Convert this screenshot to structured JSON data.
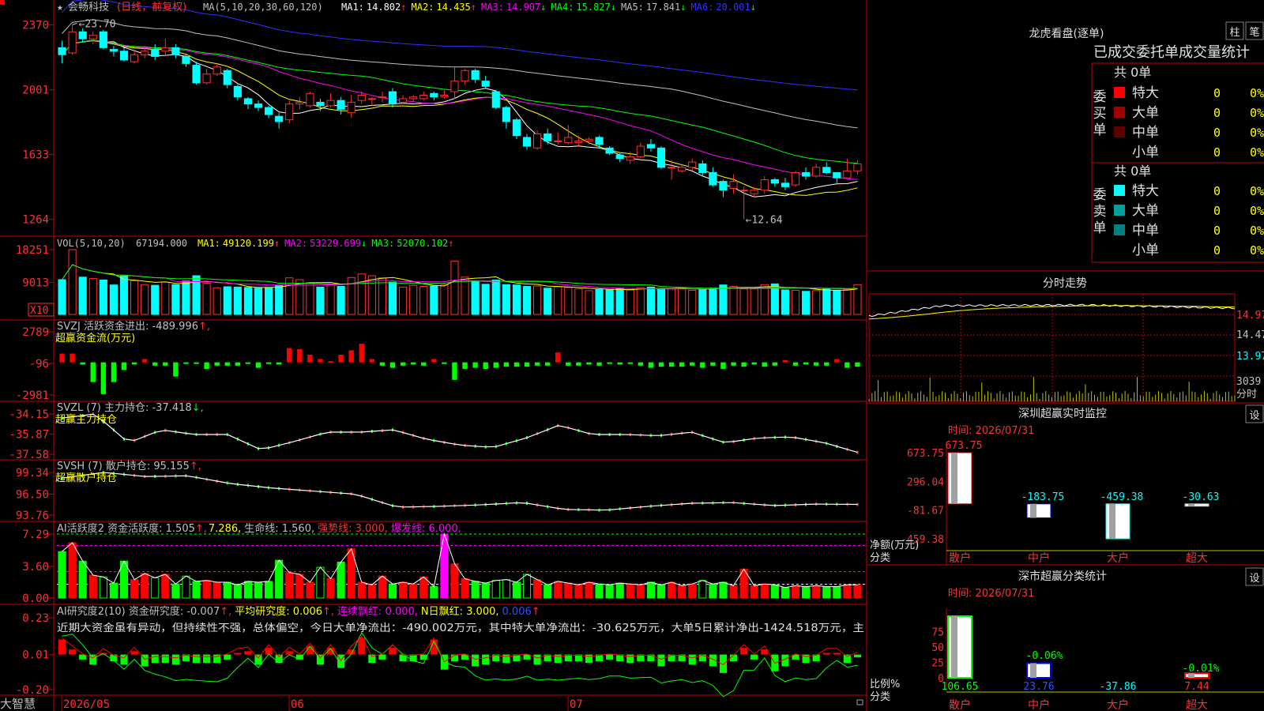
{
  "stock": {
    "name": "会畅科技",
    "period": "(日线，前复权)",
    "star": "★"
  },
  "main": {
    "ma_prefix": "MA(5,10,20,30,60,120)",
    "ma": [
      {
        "label": "MA1:",
        "value": "14.802",
        "arrow": "↑",
        "color": "#ffffff"
      },
      {
        "label": "MA2:",
        "value": "14.435",
        "arrow": "↑",
        "color": "#ffff00"
      },
      {
        "label": "MA3:",
        "value": "14.907",
        "arrow": "↓",
        "color": "#ff00ff"
      },
      {
        "label": "MA4:",
        "value": "15.827",
        "arrow": "↓",
        "color": "#00ff00"
      },
      {
        "label": "MA5:",
        "value": "17.841",
        "arrow": "↓",
        "color": "#c0c0c0"
      },
      {
        "label": "MA6:",
        "value": "20.001",
        "arrow": "↓",
        "color": "#3030ff"
      }
    ],
    "y_ticks": [
      "2370",
      "2001",
      "1633",
      "1264"
    ],
    "high_label": "23.70",
    "low_label": "12.64"
  },
  "vol": {
    "prefix": "VOL(5,10,20)",
    "value": "67194.000",
    "ma": [
      {
        "label": "MA1:",
        "value": "49120.199",
        "arrow": "↑",
        "color": "#ffff00"
      },
      {
        "label": "MA2:",
        "value": "53229.699",
        "arrow": "↓",
        "color": "#ff00ff"
      },
      {
        "label": "MA3:",
        "value": "52070.102",
        "arrow": "↑",
        "color": "#00ff00"
      }
    ],
    "y_ticks": [
      "18251",
      "9013"
    ],
    "unit": "X10"
  },
  "svzj": {
    "line1": "SVZJ  活跃资金进出: -489.996",
    "arrow": "↑,",
    "line2": "超赢资金流(万元)",
    "y_ticks": [
      "2789",
      "-96",
      "-2981"
    ]
  },
  "svzl": {
    "line1": "SVZL  (7) 主力持仓: -37.418",
    "arrow": "↓,",
    "line2": "超赢主力持仓",
    "y_ticks": [
      "-34.15",
      "-35.87",
      "-37.58"
    ]
  },
  "svsh": {
    "line1": "SVSH  (7) 散户持仓: 95.155",
    "arrow": "↑,",
    "line2": "超赢散户持仓",
    "y_ticks": [
      "99.34",
      "96.50",
      "93.76"
    ]
  },
  "ai_act": {
    "prefix": "AI活跃度2 资金活跃度: 1.505",
    "a1": "↑,",
    "v2": "7.286,",
    "v3": "生命线: 1.560,",
    "v4": "强势线: 3.000,",
    "v5": "爆发线: 6.000,",
    "y_ticks": [
      "7.29",
      "3.60",
      "0.00"
    ]
  },
  "ai_res": {
    "prefix": "AI研究度2(10) 资金研究度: -0.007",
    "a1": "↑,",
    "v2": "平均研究度: 0.006",
    "a2": "↑,",
    "v3": "连续飘红: 0.000,",
    "v4": "N日飘红: 3.000,",
    "v5": "0.006",
    "a5": "↑",
    "comment": "近期大资金虽有异动，但持续性不强，总体偏空，今日大单净流出：-490.002万元，其中特大单净流出：-30.625万元，大单5日累计净出-1424.518万元，主",
    "y_ticks": [
      "0.23",
      "0.01",
      "-0.20"
    ]
  },
  "xaxis": {
    "labels": [
      "2026/05",
      "06",
      "07"
    ],
    "brand": "大智慧"
  },
  "lhb": {
    "title": "龙虎看盘(逐单)",
    "btn1": "柱",
    "btn2": "笔",
    "subtitle": "已成交委托单成交量统计",
    "buy": {
      "side": "委买单",
      "total": "共 0单",
      "rows": [
        {
          "label": "特大",
          "count": "0",
          "pct": "0%",
          "color": "#ff0000"
        },
        {
          "label": "大单",
          "count": "0",
          "pct": "0%",
          "color": "#a00000"
        },
        {
          "label": "中单",
          "count": "0",
          "pct": "0%",
          "color": "#600000"
        },
        {
          "label": "小单",
          "count": "0",
          "pct": "0%",
          "color": "#000000"
        }
      ]
    },
    "sell": {
      "side": "委卖单",
      "total": "共 0单",
      "rows": [
        {
          "label": "特大",
          "count": "0",
          "pct": "0%",
          "color": "#00ffff"
        },
        {
          "label": "大单",
          "count": "0",
          "pct": "0%",
          "color": "#00a0a0"
        },
        {
          "label": "中单",
          "count": "0",
          "pct": "0%",
          "color": "#008080"
        },
        {
          "label": "小单",
          "count": "0",
          "pct": "0%",
          "color": "#000000"
        }
      ]
    }
  },
  "intraday": {
    "title": "分时走势",
    "y_ticks": [
      "14.97",
      "14.47",
      "13.97"
    ],
    "vol_tick": "3039",
    "vol_label": "分时"
  },
  "monitor": {
    "title": "深圳超赢实时监控",
    "btn": "设",
    "time": "时间: 2026/07/31",
    "y_ticks": [
      "673.75",
      "296.04",
      "-81.67",
      "-459.38"
    ],
    "y_label": "净额(万元)",
    "x_label": "分类",
    "cats": [
      "散户",
      "中户",
      "大户",
      "超大"
    ],
    "values": [
      "673.75",
      "-183.75",
      "-459.38",
      "-30.63"
    ]
  },
  "classify": {
    "title": "深市超赢分类统计",
    "btn": "设",
    "time": "时间: 2026/07/31",
    "y_ticks": [
      "75",
      "50",
      "25",
      "0"
    ],
    "y_label": "比例%",
    "x_label": "分类",
    "cats": [
      "散户",
      "中户",
      "大户",
      "超大"
    ],
    "values": [
      "106.65",
      "23.76",
      "-37.86",
      "7.44"
    ],
    "bar_labels": [
      "-0.06%",
      "-0.01%"
    ]
  },
  "chart_data": [
    {
      "type": "candlestick",
      "title": "会畅科技",
      "ylim": [
        12.0,
        24.3
      ],
      "candles": [
        [
          22.4,
          22.0,
          22.8,
          21.5
        ],
        [
          22.1,
          23.3,
          23.7,
          22.0
        ],
        [
          23.3,
          22.9,
          23.5,
          22.7
        ],
        [
          22.9,
          23.1,
          23.3,
          22.6
        ],
        [
          23.3,
          22.4,
          23.4,
          22.3
        ],
        [
          22.3,
          22.2,
          22.5,
          21.9
        ],
        [
          22.2,
          21.7,
          22.4,
          21.6
        ],
        [
          21.6,
          22.0,
          22.3,
          21.5
        ],
        [
          22.0,
          22.2,
          22.5,
          21.8
        ],
        [
          22.3,
          21.9,
          22.6,
          21.7
        ],
        [
          22.2,
          22.4,
          22.9,
          21.9
        ],
        [
          22.4,
          22.0,
          22.6,
          21.8
        ],
        [
          21.9,
          21.5,
          22.0,
          21.3
        ],
        [
          21.4,
          20.4,
          21.6,
          20.3
        ],
        [
          20.4,
          20.9,
          21.2,
          20.3
        ],
        [
          20.9,
          21.3,
          21.5,
          20.8
        ],
        [
          21.1,
          20.3,
          21.2,
          20.1
        ],
        [
          20.2,
          19.6,
          20.3,
          19.4
        ],
        [
          19.5,
          19.2,
          19.6,
          18.9
        ],
        [
          19.2,
          19.0,
          19.4,
          18.8
        ],
        [
          19.0,
          18.6,
          19.1,
          18.4
        ],
        [
          18.5,
          18.2,
          18.7,
          17.8
        ],
        [
          18.3,
          19.2,
          19.4,
          18.1
        ],
        [
          19.2,
          19.3,
          19.6,
          18.9
        ],
        [
          19.1,
          19.8,
          19.9,
          19.0
        ],
        [
          19.3,
          19.1,
          19.5,
          18.8
        ],
        [
          19.1,
          19.4,
          19.8,
          19.0
        ],
        [
          19.4,
          18.9,
          19.6,
          18.6
        ],
        [
          18.7,
          19.3,
          19.7,
          18.4
        ],
        [
          19.4,
          19.7,
          19.9,
          19.2
        ],
        [
          19.5,
          19.5,
          19.6,
          19.1
        ],
        [
          19.6,
          19.6,
          19.9,
          19.3
        ],
        [
          19.9,
          19.2,
          20.1,
          19.0
        ],
        [
          19.3,
          19.5,
          19.7,
          19.2
        ],
        [
          19.5,
          19.6,
          19.7,
          19.3
        ],
        [
          19.5,
          19.7,
          19.9,
          19.4
        ],
        [
          19.8,
          19.6,
          19.9,
          19.4
        ],
        [
          19.6,
          19.7,
          20.0,
          19.5
        ],
        [
          19.9,
          20.5,
          21.3,
          19.5
        ],
        [
          20.5,
          21.1,
          21.2,
          20.3
        ],
        [
          21.1,
          20.6,
          21.2,
          20.4
        ],
        [
          20.5,
          20.2,
          20.8,
          20.1
        ],
        [
          19.9,
          19.0,
          20.0,
          18.9
        ],
        [
          19.0,
          18.2,
          19.1,
          17.8
        ],
        [
          18.3,
          17.4,
          18.4,
          17.2
        ],
        [
          17.3,
          16.8,
          17.5,
          16.6
        ],
        [
          16.7,
          17.5,
          17.7,
          16.6
        ],
        [
          17.5,
          17.1,
          17.8,
          16.9
        ],
        [
          17.1,
          17.1,
          17.6,
          16.9
        ],
        [
          17.0,
          17.3,
          18.0,
          16.9
        ],
        [
          17.0,
          17.1,
          17.4,
          16.8
        ],
        [
          17.1,
          17.2,
          17.3,
          16.9
        ],
        [
          17.3,
          16.9,
          17.4,
          16.7
        ],
        [
          16.7,
          16.4,
          16.8,
          16.3
        ],
        [
          16.3,
          16.1,
          16.4,
          15.9
        ],
        [
          16.0,
          16.2,
          16.5,
          15.8
        ],
        [
          16.2,
          16.8,
          17.0,
          16.1
        ],
        [
          16.9,
          16.7,
          17.2,
          16.5
        ],
        [
          16.7,
          15.6,
          16.8,
          15.5
        ],
        [
          15.6,
          15.6,
          16.0,
          14.9
        ],
        [
          15.4,
          15.6,
          15.8,
          15.3
        ],
        [
          15.6,
          15.9,
          16.1,
          15.4
        ],
        [
          15.8,
          15.3,
          16.0,
          15.1
        ],
        [
          15.3,
          14.6,
          15.6,
          14.5
        ],
        [
          14.8,
          14.3,
          14.9,
          13.9
        ],
        [
          14.4,
          14.8,
          15.2,
          14.1
        ],
        [
          14.3,
          14.3,
          14.5,
          12.64
        ],
        [
          14.1,
          14.3,
          14.5,
          13.9
        ],
        [
          14.3,
          14.9,
          15.1,
          14.1
        ],
        [
          14.9,
          14.7,
          15.0,
          14.5
        ],
        [
          14.7,
          14.5,
          15.0,
          14.3
        ],
        [
          14.6,
          15.3,
          15.4,
          14.5
        ],
        [
          15.3,
          15.1,
          15.6,
          14.9
        ],
        [
          15.1,
          15.6,
          15.8,
          15.0
        ],
        [
          15.6,
          15.3,
          15.9,
          15.2
        ],
        [
          15.3,
          15.0,
          15.3,
          14.7
        ],
        [
          15.0,
          15.4,
          16.1,
          15.0
        ],
        [
          15.4,
          15.8,
          16.0,
          15.2
        ]
      ],
      "ma_series": [
        {
          "name": "MA1",
          "last": 14.802
        },
        {
          "name": "MA2",
          "last": 14.435
        },
        {
          "name": "MA3",
          "last": 14.907
        },
        {
          "name": "MA4",
          "last": 15.827
        },
        {
          "name": "MA5",
          "last": 17.841
        },
        {
          "name": "MA6",
          "last": 20.001
        }
      ],
      "high": 23.7,
      "low": 12.64
    },
    {
      "type": "bar",
      "title": "VOL",
      "ylim": [
        0,
        18251
      ],
      "values": [
        9800,
        18251,
        10500,
        10100,
        9700,
        8300,
        10800,
        9500,
        8400,
        8200,
        9100,
        8400,
        9400,
        10900,
        8800,
        7500,
        7800,
        7700,
        7600,
        7400,
        7500,
        8100,
        10300,
        9800,
        8900,
        7700,
        8400,
        7900,
        10400,
        11400,
        10900,
        10300,
        9100,
        7700,
        8200,
        7900,
        8000,
        8300,
        15000,
        10500,
        9300,
        8500,
        9700,
        8400,
        8300,
        7900,
        8000,
        7400,
        7800,
        7600,
        7200,
        6700,
        7000,
        6900,
        7400,
        6900,
        7500,
        7700,
        7100,
        7200,
        7300,
        6800,
        7200,
        7400,
        8300,
        7900,
        7200,
        7200,
        8400,
        8600,
        6900,
        6800,
        6500,
        6700,
        7200,
        6800,
        7000,
        8400
      ]
    },
    {
      "type": "bar",
      "title": "SVZJ",
      "ylim": [
        -2981,
        2789
      ],
      "values": [
        800,
        800,
        -200,
        -1800,
        -2900,
        -1800,
        -700,
        -200,
        300,
        -300,
        -300,
        -1300,
        -100,
        -100,
        -600,
        -300,
        -300,
        -300,
        -100,
        -500,
        -100,
        -200,
        1300,
        1200,
        700,
        300,
        100,
        700,
        1100,
        1700,
        300,
        -300,
        -500,
        -300,
        -200,
        -300,
        300,
        -100,
        -1600,
        -600,
        -500,
        -600,
        -500,
        -400,
        -400,
        -400,
        -300,
        -300,
        900,
        -300,
        -300,
        -200,
        -300,
        -100,
        -200,
        -100,
        -300,
        -500,
        -400,
        -400,
        -400,
        -300,
        -500,
        -300,
        -600,
        -300,
        -400,
        -200,
        -400,
        -300,
        200,
        -300,
        -200,
        -300,
        -300,
        300,
        -500,
        -400
      ]
    },
    {
      "type": "line",
      "title": "SVZL",
      "ylim": [
        -37.58,
        -34.15
      ],
      "values_sample": [
        -34.5,
        -34.15,
        -36.6,
        -35.5,
        -35.9,
        -35.9,
        -37.2,
        -36.5,
        -35.7,
        -35.7,
        -35.5,
        -36.3,
        -36.8,
        -37.0,
        -36.2,
        -35.1,
        -35.9,
        -35.9,
        -36.0,
        -35.7,
        -36.6,
        -36.2,
        -36.1,
        -36.6,
        -37.418
      ]
    },
    {
      "type": "line",
      "title": "SVSH",
      "ylim": [
        93.76,
        99.34
      ],
      "values_sample": [
        98.6,
        99.34,
        98.8,
        98.9,
        97.9,
        97.3,
        96.9,
        96.5,
        94.8,
        94.9,
        95.1,
        95.4,
        94.5,
        94.4,
        94.9,
        95.3,
        95.4,
        95.0,
        95.2,
        95.155
      ]
    },
    {
      "type": "bar",
      "title": "AI活跃度2",
      "ylim": [
        0,
        7.29
      ],
      "lines": {
        "生命线": 1.56,
        "强势线": 3.0,
        "爆发线": 6.0
      },
      "values": [
        5.3,
        6.3,
        4.2,
        2.6,
        2.4,
        1.7,
        4.2,
        2.1,
        2.8,
        2.3,
        2.7,
        1.6,
        2.5,
        1.9,
        2.0,
        1.8,
        1.8,
        1.5,
        1.9,
        1.8,
        1.9,
        4.3,
        2.9,
        2.7,
        1.8,
        3.5,
        2.2,
        4.1,
        5.6,
        1.8,
        1.5,
        2.5,
        1.6,
        1.8,
        1.6,
        2.4,
        1.3,
        7.29,
        3.9,
        2.2,
        1.9,
        1.7,
        2.0,
        2.1,
        1.8,
        2.7,
        2.1,
        1.5,
        1.9,
        1.7,
        1.5,
        1.8,
        1.6,
        1.5,
        1.7,
        1.6,
        1.5,
        1.8,
        1.5,
        1.8,
        1.4,
        1.6,
        2.0,
        1.6,
        1.8,
        1.4,
        3.3,
        1.4,
        1.6,
        1.5,
        1.2,
        1.4,
        1.3,
        1.4,
        1.3,
        1.3,
        1.5,
        1.505
      ]
    },
    {
      "type": "bar",
      "title": "AI研究度2",
      "ylim": [
        -0.2,
        0.23
      ],
      "values": [
        0.1,
        0.04,
        -0.02,
        -0.05,
        0.02,
        -0.03,
        -0.05,
        0.03,
        -0.06,
        -0.04,
        -0.04,
        -0.05,
        -0.03,
        -0.04,
        -0.04,
        -0.04,
        -0.02,
        0.02,
        0.03,
        -0.05,
        0.05,
        -0.04,
        0.03,
        -0.02,
        0.06,
        -0.05,
        0.05,
        -0.07,
        0.04,
        0.11,
        -0.04,
        -0.02,
        0.05,
        -0.03,
        -0.03,
        -0.02,
        0.1,
        -0.08,
        -0.03,
        -0.02,
        -0.06,
        -0.05,
        -0.03,
        -0.04,
        -0.03,
        -0.02,
        -0.05,
        -0.03,
        -0.04,
        -0.03,
        -0.03,
        -0.04,
        -0.03,
        -0.02,
        -0.03,
        -0.04,
        -0.03,
        -0.03,
        -0.06,
        -0.03,
        -0.03,
        -0.05,
        -0.03,
        -0.06,
        -0.1,
        -0.03,
        0.05,
        -0.02,
        0.04,
        -0.09,
        -0.06,
        -0.02,
        -0.04,
        -0.03,
        0.02,
        0.02,
        -0.04,
        -0.007
      ]
    },
    {
      "type": "bar",
      "title": "深圳超赢实时监控",
      "categories": [
        "散户",
        "中户",
        "大户",
        "超大"
      ],
      "values": [
        673.75,
        -183.75,
        -459.38,
        -30.63
      ],
      "ylim": [
        -459.38,
        673.75
      ]
    },
    {
      "type": "bar",
      "title": "深市超赢分类统计",
      "categories": [
        "散户",
        "中户",
        "大户",
        "超大"
      ],
      "values": [
        106.65,
        23.76,
        -37.86,
        7.44
      ],
      "ylim": [
        0,
        75
      ]
    }
  ]
}
